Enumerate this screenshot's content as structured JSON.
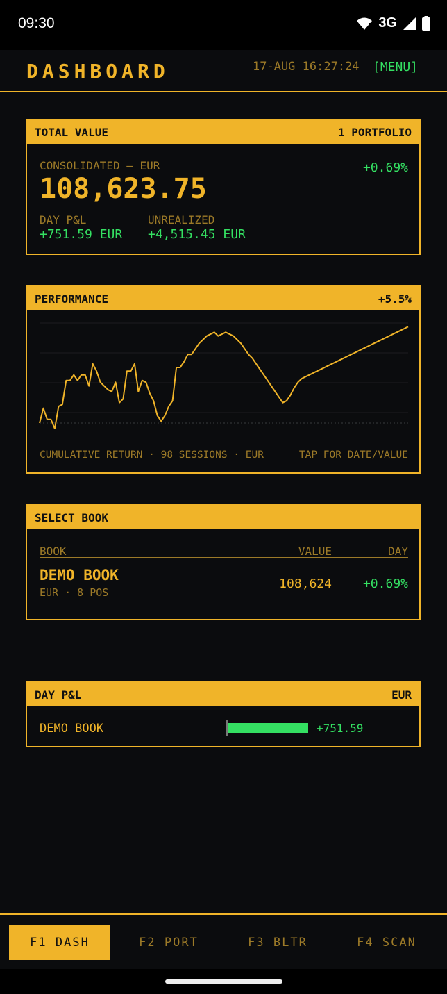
{
  "status_bar": {
    "time": "09:30",
    "network": "3G"
  },
  "header": {
    "title": "DASHBOARD",
    "clock": "17-AUG 16:27:24",
    "menu_label": "[MENU]"
  },
  "total_value": {
    "title": "TOTAL VALUE",
    "portfolio_count": "1 PORTFOLIO",
    "label": "CONSOLIDATED — EUR",
    "change_pct": "+0.69%",
    "amount": "108,623.75",
    "day_pl_label": "DAY P&L",
    "day_pl_value": "+751.59 EUR",
    "unrealized_label": "UNREALIZED",
    "unrealized_value": "+4,515.45 EUR"
  },
  "performance": {
    "title": "PERFORMANCE",
    "return_pct": "+5.5%",
    "caption": "CUMULATIVE RETURN · 98 SESSIONS · EUR",
    "tap_hint": "TAP FOR DATE/VALUE",
    "line_color": "#f0b429"
  },
  "chart_data": {
    "type": "line",
    "series": [
      {
        "values": [
          1.2,
          2.8,
          1.6,
          1.6,
          0.6,
          3.0,
          3.2,
          5.8,
          5.8,
          6.4,
          5.8,
          6.4,
          6.4,
          5.2,
          7.6,
          6.8,
          5.6,
          5.2,
          4.8,
          4.6,
          5.6,
          3.4,
          3.8,
          6.8,
          6.8,
          7.6,
          4.6,
          5.8,
          5.6,
          4.4,
          3.6,
          2.0,
          1.4,
          2.0,
          3.0,
          3.6,
          7.2,
          7.2,
          7.8,
          8.6,
          8.6,
          9.2,
          9.8,
          10.2,
          10.6,
          10.8,
          11.0,
          10.6,
          10.8,
          11.0,
          10.8,
          10.6,
          10.2,
          9.8,
          9.2,
          8.6,
          8.2,
          7.6,
          7.0,
          6.4,
          5.8,
          5.2,
          4.6,
          4.0,
          3.4,
          3.6,
          4.2,
          5.0,
          5.6,
          6.0,
          6.2,
          6.4,
          6.6,
          6.8,
          7.0,
          7.2,
          7.4,
          7.6,
          7.8,
          8.0,
          8.2,
          8.4,
          8.6,
          8.8,
          9.0,
          9.2,
          9.4,
          9.6,
          9.8,
          10.0,
          10.2,
          10.4,
          10.6,
          10.8,
          11.0,
          11.2,
          11.4,
          11.6
        ]
      }
    ],
    "grid": true,
    "zero_line": "dashed"
  },
  "book": {
    "title": "SELECT BOOK",
    "col_book": "BOOK",
    "col_value": "VALUE",
    "col_day": "DAY",
    "rows": [
      {
        "name": "DEMO BOOK",
        "meta": "EUR · 8 POS",
        "value": "108,624",
        "day": "+0.69%"
      }
    ]
  },
  "day_pl": {
    "title": "DAY P&L",
    "currency": "EUR",
    "rows": [
      {
        "name": "DEMO BOOK",
        "value": "+751.59",
        "bar_fraction": 1.0
      }
    ]
  },
  "nav": {
    "tabs": [
      "F1 DASH",
      "F2 PORT",
      "F3 BLTR",
      "F4 SCAN"
    ],
    "active": 0
  },
  "colors": {
    "accent": "#f0b429",
    "positive": "#34e062",
    "muted": "#9c7a28",
    "background": "#0b0c0e"
  }
}
